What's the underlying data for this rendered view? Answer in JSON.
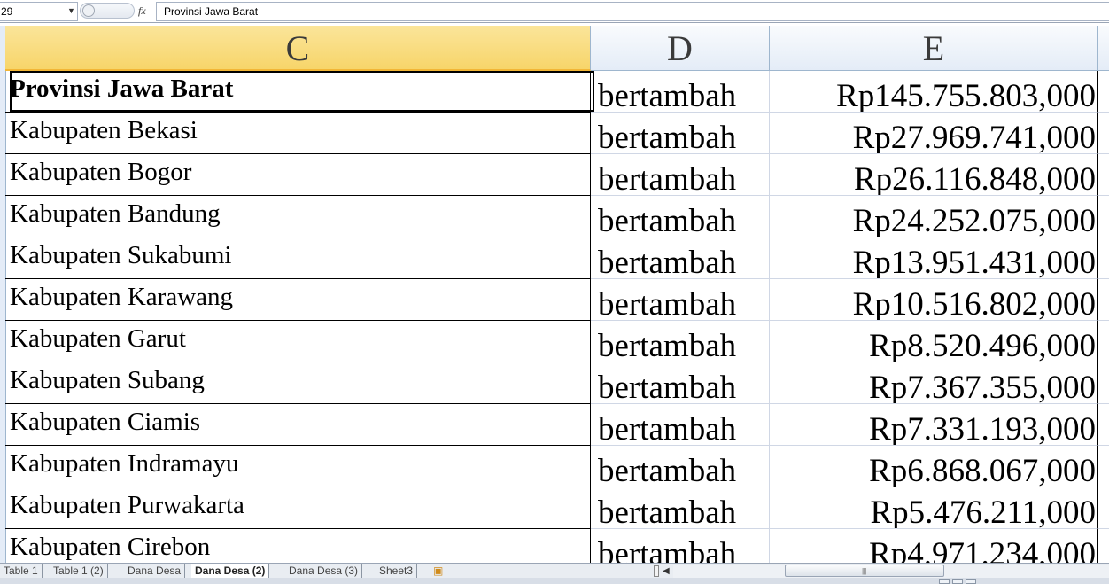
{
  "formula_bar": {
    "name_box": "29",
    "fx_label": "fx",
    "formula_value": "Provinsi Jawa Barat"
  },
  "columns": [
    {
      "label": "C",
      "selected": true
    },
    {
      "label": "D",
      "selected": false
    },
    {
      "label": "E",
      "selected": false
    }
  ],
  "rows": [
    {
      "c": "Provinsi Jawa Barat",
      "d": "bertambah",
      "e": "Rp145.755.803,000",
      "bold": true
    },
    {
      "c": "Kabupaten Bekasi",
      "d": "bertambah",
      "e": "Rp27.969.741,000"
    },
    {
      "c": "Kabupaten Bogor",
      "d": "bertambah",
      "e": "Rp26.116.848,000"
    },
    {
      "c": "Kabupaten Bandung",
      "d": "bertambah",
      "e": "Rp24.252.075,000"
    },
    {
      "c": "Kabupaten Sukabumi",
      "d": "bertambah",
      "e": "Rp13.951.431,000"
    },
    {
      "c": "Kabupaten Karawang",
      "d": "bertambah",
      "e": "Rp10.516.802,000"
    },
    {
      "c": "Kabupaten Garut",
      "d": "bertambah",
      "e": "Rp8.520.496,000"
    },
    {
      "c": "Kabupaten Subang",
      "d": "bertambah",
      "e": "Rp7.367.355,000"
    },
    {
      "c": "Kabupaten Ciamis",
      "d": "bertambah",
      "e": "Rp7.331.193,000"
    },
    {
      "c": "Kabupaten Indramayu",
      "d": "bertambah",
      "e": "Rp6.868.067,000"
    },
    {
      "c": "Kabupaten Purwakarta",
      "d": "bertambah",
      "e": "Rp5.476.211,000"
    },
    {
      "c": "Kabupaten Cirebon",
      "d": "bertambah",
      "e": "Rp4.971.234,000"
    }
  ],
  "sheet_tabs": [
    {
      "label": "Table 1",
      "active": false
    },
    {
      "label": "Table 1 (2)",
      "active": false
    },
    {
      "label": "Dana Desa",
      "active": false
    },
    {
      "label": "Dana Desa (2)",
      "active": true
    },
    {
      "label": "Dana Desa (3)",
      "active": false
    },
    {
      "label": "Sheet3",
      "active": false
    }
  ],
  "icons": {
    "name_box_dropdown": "chevron-down-icon",
    "insert_sheet": "insert-sheet-icon",
    "scroll_left": "scroll-left-icon"
  },
  "colors": {
    "selected_header": "#f7d56a",
    "header": "#e4ecf7",
    "gridline": "#d0d7e5"
  }
}
